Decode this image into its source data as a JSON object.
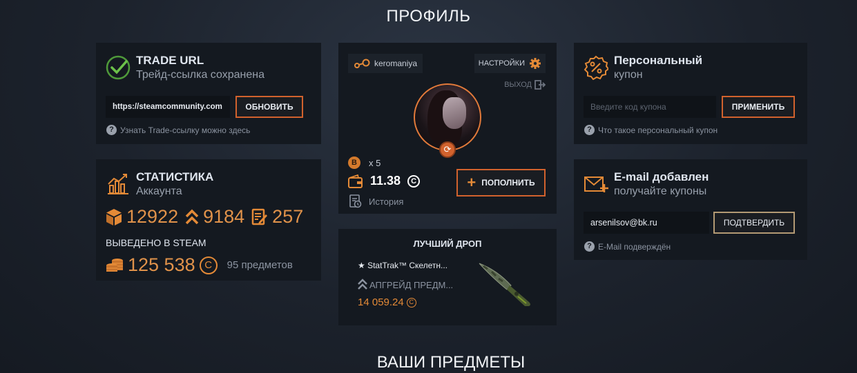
{
  "page": {
    "title": "ПРОФИЛЬ",
    "items_title": "ВАШИ ПРЕДМЕТЫ"
  },
  "trade": {
    "title": "TRADE URL",
    "subtitle": "Трейд-ссылка сохранена",
    "url_value": "https://steamcommunity.com",
    "update_label": "ОБНОВИТЬ",
    "hint": "Узнать Trade-ссылку можно здесь"
  },
  "stats": {
    "title": "СТАТИСТИКА",
    "subtitle": "Аккаунта",
    "cases": "12922",
    "upgrades": "9184",
    "contracts": "257",
    "withdrawn_label": "ВЫВЕДЕНО В STEAM",
    "withdrawn_amount": "125 538",
    "withdrawn_items": "95 предметов"
  },
  "profile": {
    "username": "keromaniya",
    "settings_label": "НАСТРОЙКИ",
    "logout_label": "ВЫХОД",
    "multiplier": "x 5",
    "balance": "11.38",
    "topup_label": "ПОПОЛНИТЬ",
    "history_label": "История"
  },
  "best_drop": {
    "title": "ЛУЧШИЙ ДРОП",
    "item_name": "★ StatTrak™ Скелетн...",
    "source": "АПГРЕЙД ПРЕДМ...",
    "price": "14 059.24"
  },
  "coupon": {
    "title": "Персональный",
    "subtitle": "купон",
    "placeholder": "Введите код купона",
    "apply_label": "ПРИМЕНИТЬ",
    "hint": "Что такое персональный купон"
  },
  "email": {
    "title": "E-mail добавлен",
    "subtitle": "получайте купоны",
    "value": "arsenilsov@bk.ru",
    "confirm_label": "ПОДТВЕРДИТЬ",
    "hint": "E-Mail подверждён"
  },
  "colors": {
    "accent": "#e48a37",
    "button_border": "#d2622d",
    "card_bg": "#141920"
  }
}
